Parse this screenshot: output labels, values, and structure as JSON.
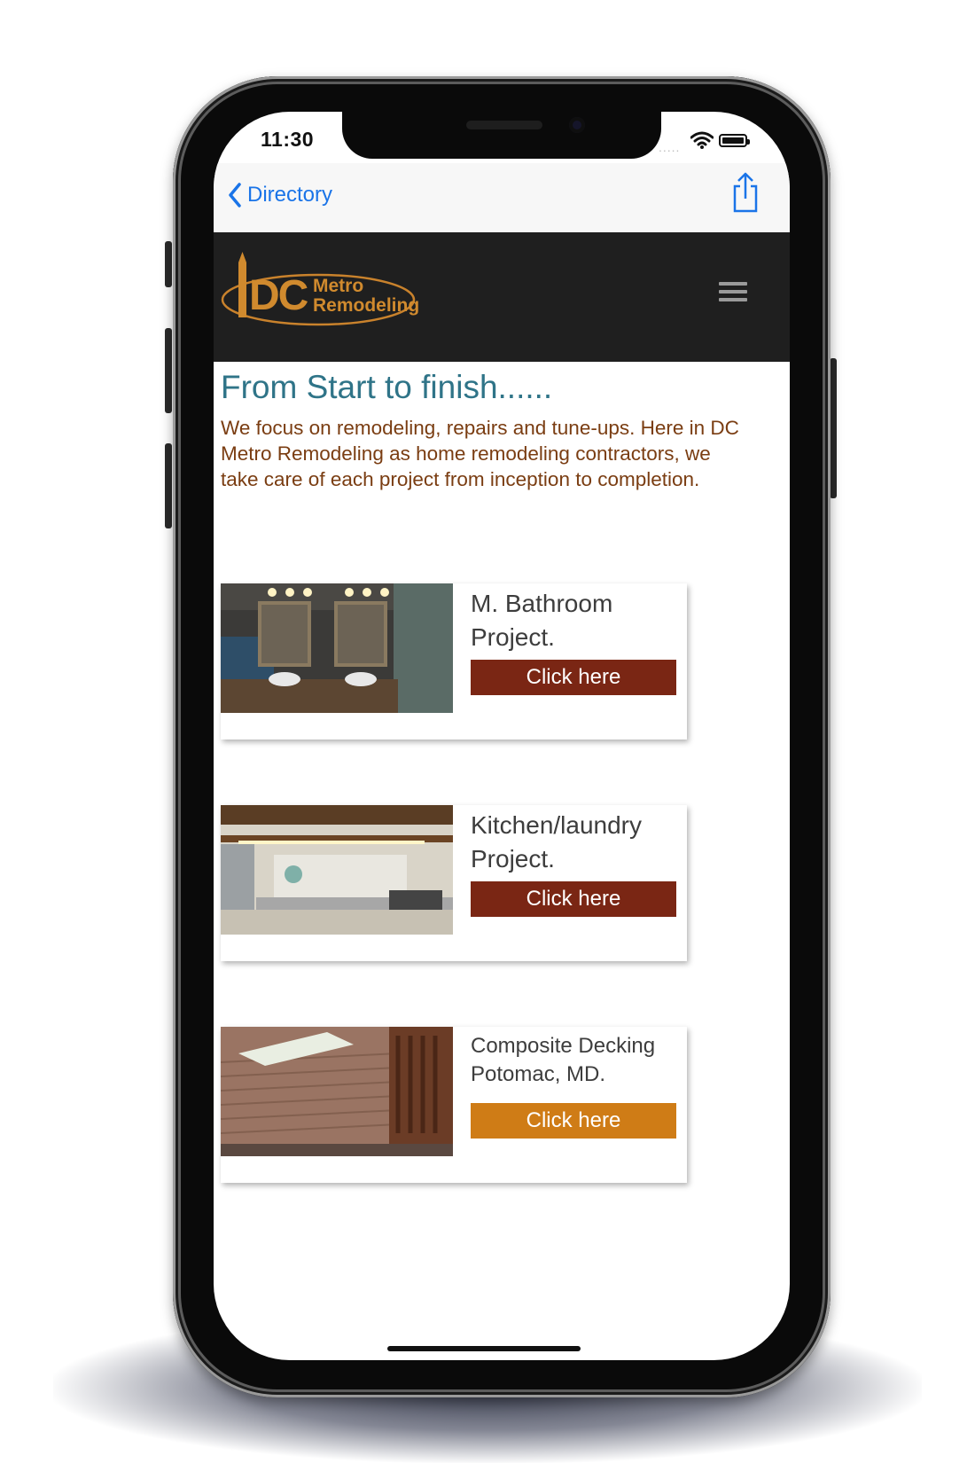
{
  "status_bar": {
    "time": "11:30",
    "signal": "....."
  },
  "nav": {
    "back_label": "Directory"
  },
  "header": {
    "logo_dc": "DC",
    "logo_metro": "Metro",
    "logo_remodeling": "Remodeling"
  },
  "main": {
    "headline": "From Start to finish......",
    "intro": "We focus on remodeling, repairs and tune-ups. Here in DC Metro Remodeling as home remodeling contractors, we take care of each project from inception to completion."
  },
  "projects": [
    {
      "title": "M. Bathroom Project.",
      "button": "Click here",
      "button_color": "#7a2614"
    },
    {
      "title": "Kitchen/laundry Project.",
      "button": "Click here",
      "button_color": "#7a2614"
    },
    {
      "title": "Composite Decking Potomac, MD.",
      "button": "Click here",
      "button_color": "#cf7c16"
    }
  ],
  "colors": {
    "header_bg": "#1f1f1f",
    "brand_orange": "#d08a2e",
    "headline_teal": "#2f7488",
    "intro_brown": "#7a3d12",
    "ios_blue": "#1a74e8"
  }
}
